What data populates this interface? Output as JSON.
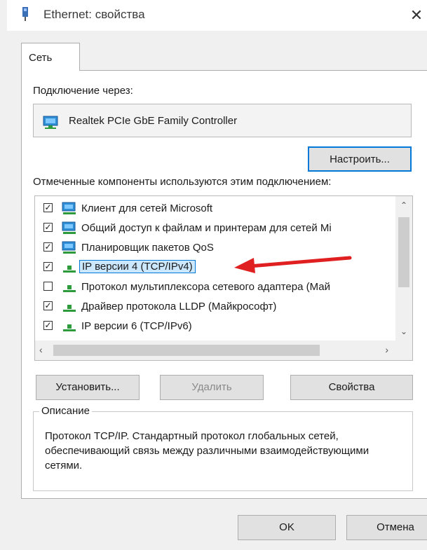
{
  "window": {
    "title": "Ethernet: свойства"
  },
  "tabs": [
    {
      "label": "Сеть"
    }
  ],
  "connection": {
    "label": "Подключение через:",
    "adapter": "Realtek PCIe GbE Family Controller",
    "configure_button": "Настроить..."
  },
  "components": {
    "label": "Отмеченные компоненты используются этим подключением:",
    "items": [
      {
        "label": "Клиент для сетей Microsoft",
        "checked": true,
        "icon": "network-client-icon"
      },
      {
        "label": "Общий доступ к файлам и принтерам для сетей Mi",
        "checked": true,
        "icon": "network-service-icon"
      },
      {
        "label": "Планировщик пакетов QoS",
        "checked": true,
        "icon": "network-service-icon"
      },
      {
        "label": "IP версии 4 (TCP/IPv4)",
        "checked": true,
        "icon": "network-protocol-icon",
        "selected": true
      },
      {
        "label": "Протокол мультиплексора сетевого адаптера (Май",
        "checked": false,
        "icon": "network-protocol-icon"
      },
      {
        "label": "Драйвер протокола LLDP (Майкрософт)",
        "checked": true,
        "icon": "network-protocol-icon"
      },
      {
        "label": "IP версии 6 (TCP/IPv6)",
        "checked": true,
        "icon": "network-protocol-icon"
      }
    ]
  },
  "buttons": {
    "install": "Установить...",
    "remove": "Удалить",
    "properties": "Свойства",
    "ok": "OK",
    "cancel": "Отмена"
  },
  "description": {
    "title": "Описание",
    "text": "Протокол TCP/IP. Стандартный протокол глобальных сетей, обеспечивающий связь между различными взаимодействующими сетями."
  },
  "colors": {
    "selection_bg": "#cce8ff",
    "selection_border": "#0078d7",
    "annotation_arrow": "#e02020"
  }
}
